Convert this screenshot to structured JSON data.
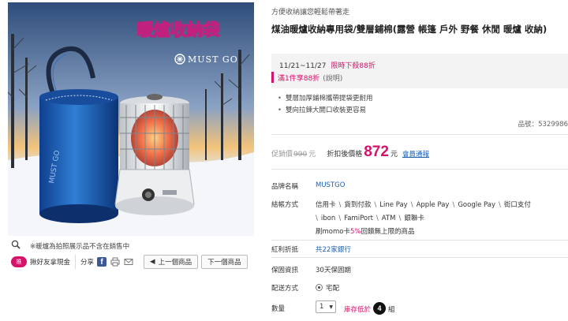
{
  "hero": {
    "banner_text": "暖爐收納袋",
    "brand_logo": "MUST GO",
    "zoom_icon": "magnifier-icon",
    "disclaimer": "※暖爐為拍照展示品不含在銷售中"
  },
  "share": {
    "promo_badge": "推",
    "promo_text": "揪好友拿現金",
    "share_label": "分享",
    "facebook_icon": "f",
    "prev_button": "上一個商品",
    "next_button": "下一個商品"
  },
  "product": {
    "tagline": "方便收納讓您輕鬆帶著走",
    "title": "煤油暖爐收納專用袋/雙層鋪棉(露營 帳篷 戶外 野餐 休閒 暖爐 收納)",
    "promo": {
      "date_range": "11/21~11/27",
      "date_highlight": "限時下殺88折",
      "bundle": "滿1件享88折",
      "bundle_note": "(說明)"
    },
    "features": [
      "雙層加厚鋪棉攜帶提袋更耐用",
      "雙向拉鍊大開口收裝更容易"
    ],
    "sku": "品號：5329986",
    "price": {
      "orig_label": "促銷價",
      "orig_value": "990",
      "orig_unit": "元",
      "disc_label": "折扣後價格",
      "disc_value": "872",
      "disc_unit": "元",
      "notify": "會員通報"
    },
    "brand": {
      "label": "品牌名稱",
      "value": "MUSTGO"
    },
    "payment": {
      "label": "結帳方式",
      "line1": [
        "信用卡",
        "貨到付款",
        "Line Pay",
        "Apple Pay",
        "Google Pay",
        "街口支付"
      ],
      "line2": [
        "ibon",
        "FamiPort",
        "ATM",
        "銀聯卡"
      ],
      "line3_pre": "刷momo卡",
      "line3_pct": "5%",
      "line3_post": "回饋無上限的商品"
    },
    "bonus": {
      "label": "紅利折抵",
      "value": "共22家銀行"
    },
    "warranty": {
      "label": "保固資訊",
      "value": "30天保固期"
    },
    "delivery": {
      "label": "配送方式",
      "value": "宅配"
    },
    "quantity": {
      "label": "數量",
      "value": "1",
      "stock_pre": "庫存低於",
      "stock_num": "4",
      "stock_unit": "組"
    }
  }
}
